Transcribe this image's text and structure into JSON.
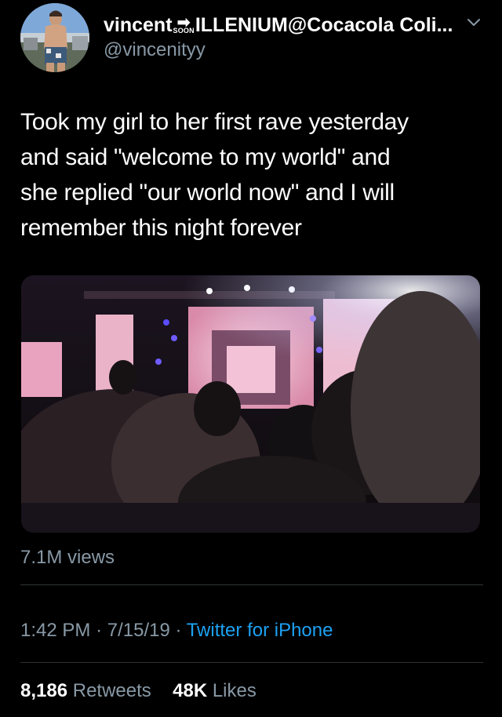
{
  "author": {
    "display_name_start": "vincent",
    "arrow_badge_text": "SOON",
    "display_name_end": "ILLENIUM@Cocacola Coli...",
    "handle": "@vincenityy"
  },
  "tweet": {
    "text": "Took my girl to her first rave yesterday\nand said \"welcome to my world\" and\nshe replied \"our world now\" and I will\nremember this night forever",
    "views": "7.1M views",
    "time": "1:42 PM",
    "separator": "·",
    "date": "7/15/19",
    "source": "Twitter for iPhone"
  },
  "stats": {
    "retweets_count": "8,186",
    "retweets_label": "Retweets",
    "likes_count": "48K",
    "likes_label": "Likes"
  },
  "icons": {
    "avatar": "profile-photo",
    "chevron": "chevron-down-icon",
    "badge_arrow": "right-arrow-icon"
  },
  "colors": {
    "background": "#000000",
    "text_primary": "#ffffff",
    "text_secondary": "#8899a6",
    "link": "#1da1f2",
    "divider": "#2f3336"
  }
}
